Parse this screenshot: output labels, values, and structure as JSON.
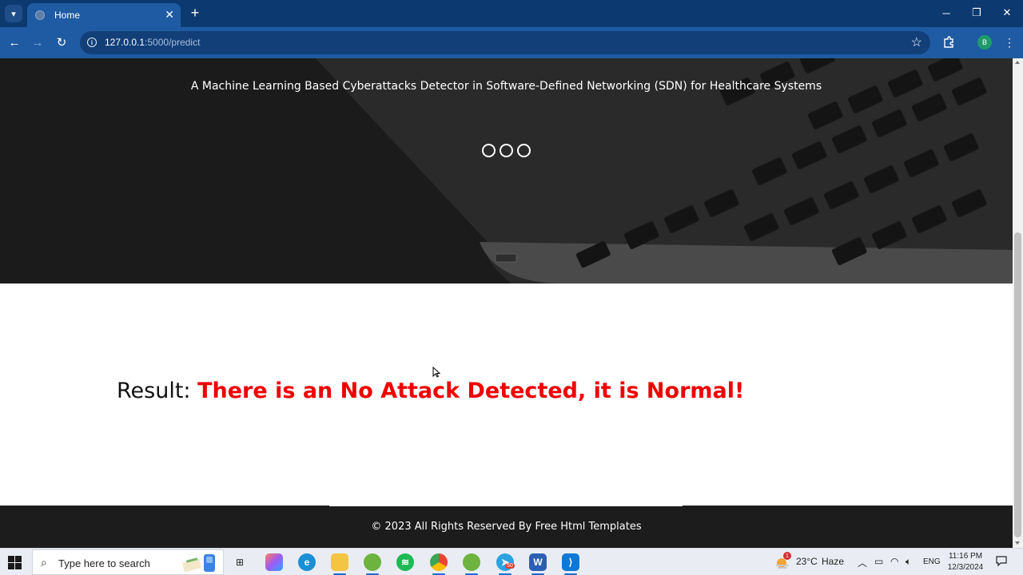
{
  "browser": {
    "tab_title": "Home",
    "url_host": "127.0.0.1",
    "url_path": ":5000/predict",
    "profile_initial": "B"
  },
  "hero": {
    "subtitle": "A Machine Learning Based Cyberattacks Detector in Software-Defined Networking (SDN) for Healthcare Systems",
    "slide_count": 3
  },
  "result": {
    "label": "Result: ",
    "value": "There is an No Attack Detected, it is Normal!"
  },
  "footer": {
    "text": "© 2023 All Rights Reserved By Free Html Templates"
  },
  "taskbar": {
    "search_placeholder": "Type here to search",
    "apps": [
      "task-view",
      "copilot",
      "edge",
      "file-explorer",
      "spring-tool",
      "spotify",
      "chrome",
      "spring-tool-2",
      "telegram",
      "word",
      "vscode"
    ],
    "weather_temp": "23°C",
    "weather_desc": "Haze",
    "weather_badge": "1",
    "telegram_badge": "50",
    "language": "ENG",
    "time": "11:16 PM",
    "date": "12/3/2024"
  },
  "colors": {
    "chrome_dark": "#0c3a70",
    "chrome": "#1f5ba3",
    "result_value": "#e00000",
    "footer_bg": "#1c1c1c"
  }
}
